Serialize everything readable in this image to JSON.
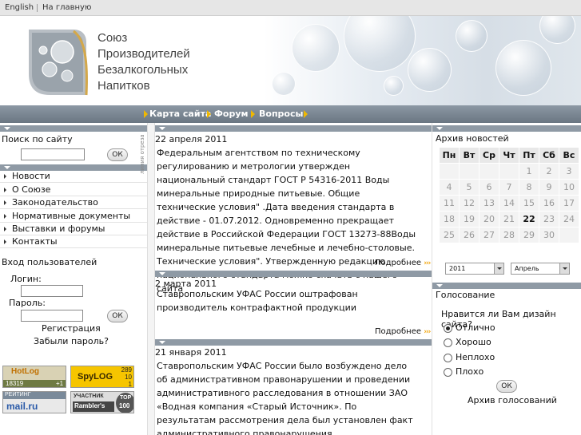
{
  "topbar": {
    "english": "English",
    "home": "На главную"
  },
  "logo": {
    "line1": "Союз",
    "line2": "Производителей",
    "line3": "Безалкогольных",
    "line4": "Напитков"
  },
  "nav": {
    "items": [
      "Карта сайта",
      "Форум",
      "Вопросы"
    ]
  },
  "search": {
    "title": "Поиск по сайту",
    "ok": "ОК"
  },
  "menu": {
    "items": [
      "Новости",
      "О Союзе",
      "Законодательство",
      "Нормативные документы",
      "Выставки и форумы",
      "Контакты"
    ]
  },
  "login": {
    "title": "Вход пользователей",
    "login_label": "Логин:",
    "password_label": "Пароль:",
    "ok": "ОК",
    "register": "Регистрация",
    "forgot": "Забыли пароль?"
  },
  "counters": {
    "hotlog": {
      "label": "HotLog",
      "num": "18319",
      "plus": "+1"
    },
    "spylog": {
      "label": "SpyLOG",
      "n1": "289",
      "n2": "10",
      "n3": "1"
    },
    "mailru": {
      "top": "РЕЙТИНГ",
      "label": "mail.ru"
    },
    "rambler": {
      "top": "УЧАСТНИК",
      "label": "Rambler's",
      "badge_top": "TOP",
      "badge_num": "100"
    }
  },
  "vertical_strip": {
    "text": "линия отреза"
  },
  "news": {
    "more": "Подробнее",
    "items": [
      {
        "date": "22 апреля 2011",
        "text": "Федеральным агентством по техническому регулированию и метрологии утвержден национальный стандарт ГОСТ Р 54316-2011 Воды минеральные природные питьевые. Общие технические условия\" .Дата введения стандарта в действие - 01.07.2012. Одновременно прекращает действие в Российской Федерации ГОСТ 13273-88Воды минеральные питьевые лечебные и лечебно-столовые. Технические условия\". Утвержденную редакцию национального стандарта можно скачать с нашего сайта"
      },
      {
        "date": "2 марта 2011",
        "text": "Ставропольским УФАС России оштрафован производитель контрафактной продукции"
      },
      {
        "date": "21 января 2011",
        "text": "Ставропольским УФАС России было возбуждено дело об административном правонарушении и проведении административного расследования в отношении ЗАО «Водная компания «Старый Источник». По результатам рассмотрения дела был установлен факт административного правонарушения."
      }
    ]
  },
  "archive": {
    "title": "Архив новостей",
    "weekdays": [
      "Пн",
      "Вт",
      "Ср",
      "Чт",
      "Пт",
      "Сб",
      "Вс"
    ],
    "weeks": [
      [
        "",
        "",
        "",
        "",
        "1",
        "2",
        "3"
      ],
      [
        "4",
        "5",
        "6",
        "7",
        "8",
        "9",
        "10"
      ],
      [
        "11",
        "12",
        "13",
        "14",
        "15",
        "16",
        "17"
      ],
      [
        "18",
        "19",
        "20",
        "21",
        "22",
        "23",
        "24"
      ],
      [
        "25",
        "26",
        "27",
        "28",
        "29",
        "30",
        ""
      ]
    ],
    "today": "22",
    "year": "2011",
    "month": "Апрель"
  },
  "poll": {
    "title": "Голосование",
    "question": "Нравится ли Вам дизайн сайта?",
    "options": [
      "Отлично",
      "Хорошо",
      "Неплохо",
      "Плохо"
    ],
    "selected_index": 0,
    "ok": "ОК",
    "archive": "Архив голосований"
  },
  "colors": {
    "nav_bar": "#7a8692",
    "section_bar": "#8f9aa5",
    "arrow": "#f0b800"
  }
}
